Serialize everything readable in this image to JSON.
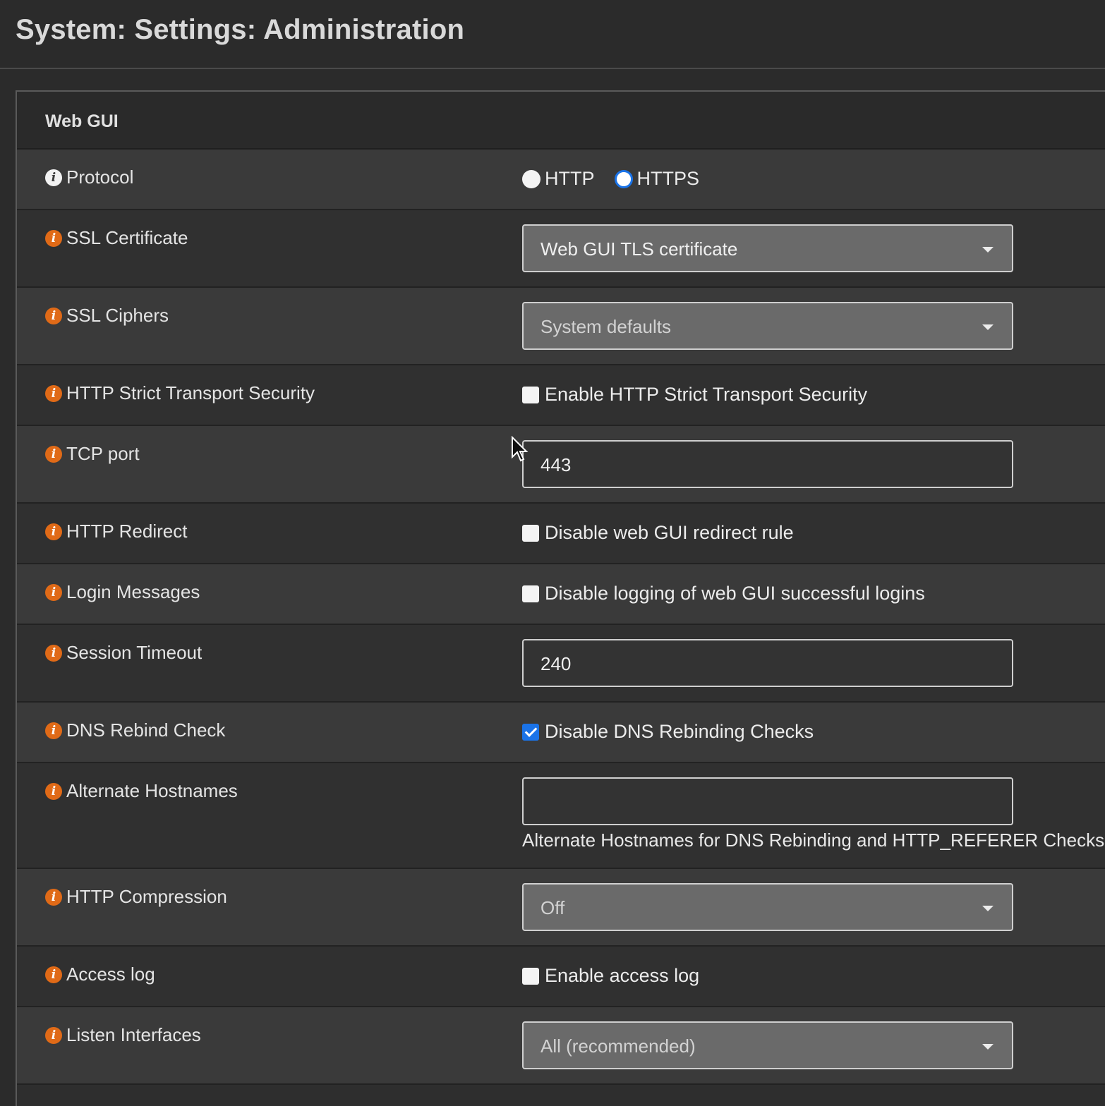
{
  "page": {
    "title": "System: Settings: Administration"
  },
  "section": {
    "title": "Web GUI"
  },
  "protocol": {
    "label": "Protocol",
    "options": [
      "HTTP",
      "HTTPS"
    ],
    "selected": "HTTPS"
  },
  "ssl_certificate": {
    "label": "SSL Certificate",
    "value": "Web GUI TLS certificate"
  },
  "ssl_ciphers": {
    "label": "SSL Ciphers",
    "value": "System defaults"
  },
  "hsts": {
    "label": "HTTP Strict Transport Security",
    "checkbox_label": "Enable HTTP Strict Transport Security",
    "checked": false
  },
  "tcp_port": {
    "label": "TCP port",
    "value": "443"
  },
  "http_redirect": {
    "label": "HTTP Redirect",
    "checkbox_label": "Disable web GUI redirect rule",
    "checked": false
  },
  "login_messages": {
    "label": "Login Messages",
    "checkbox_label": "Disable logging of web GUI successful logins",
    "checked": false
  },
  "session_timeout": {
    "label": "Session Timeout",
    "value": "240"
  },
  "dns_rebind": {
    "label": "DNS Rebind Check",
    "checkbox_label": "Disable DNS Rebinding Checks",
    "checked": true
  },
  "alternate_hostnames": {
    "label": "Alternate Hostnames",
    "value": "",
    "help": "Alternate Hostnames for DNS Rebinding and HTTP_REFERER Checks"
  },
  "http_compression": {
    "label": "HTTP Compression",
    "value": "Off"
  },
  "access_log": {
    "label": "Access log",
    "checkbox_label": "Enable access log",
    "checked": false
  },
  "listen_interfaces": {
    "label": "Listen Interfaces",
    "value": "All (recommended)"
  },
  "icons": {
    "info": "info-icon",
    "cursor": "mouse-pointer-icon"
  },
  "colors": {
    "info_icon": "#e06a17",
    "checkbox_checked": "#1a73e8",
    "background": "#2b2b2b"
  }
}
